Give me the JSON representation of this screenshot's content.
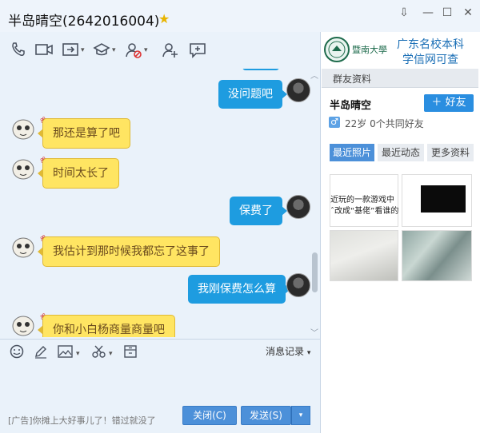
{
  "window": {
    "title": "半岛晴空(2642016004)",
    "controls": [
      "⇩",
      "—",
      "☐",
      "✕"
    ]
  },
  "toolbar": {
    "icons": [
      "phone-icon",
      "video-icon",
      "share-screen-icon",
      "app-icon",
      "block-user-icon",
      "add-member-icon",
      "share-screen-text-icon"
    ]
  },
  "messages": [
    {
      "side": "right",
      "text": "没问题吧"
    },
    {
      "side": "left",
      "text": "那还是算了吧"
    },
    {
      "side": "left",
      "text": "时间太长了"
    },
    {
      "side": "right",
      "text": "保费了"
    },
    {
      "side": "left",
      "text": "我估计到那时候我都忘了这事了"
    },
    {
      "side": "right",
      "text": "我刚保费怎么算"
    },
    {
      "side": "left",
      "text": "你和小白杨商量商量吧"
    }
  ],
  "input_toolbar": {
    "history_label": "消息记录"
  },
  "bottom": {
    "ad_text": "[广告]你摊上大好事儿了！错过就没了",
    "close_label": "关闭(C)",
    "send_label": "发送(S)"
  },
  "banner": {
    "school_name": "暨南大學",
    "line1": "广东名校本科",
    "line2": "学信网可查"
  },
  "profile": {
    "section_title": "群友资料",
    "name": "半岛晴空",
    "add_friend_label": "好友",
    "info": "22岁 0个共同好友",
    "gender_symbol": "♂"
  },
  "tabs": [
    {
      "label": "最近照片",
      "active": true
    },
    {
      "label": "最近动态",
      "active": false
    },
    {
      "label": "更多资料",
      "active": false
    }
  ],
  "photos": {
    "photo1_lines": [
      "近玩的一款游戏中",
      "ˆ改成“基佬”看谁的"
    ]
  }
}
